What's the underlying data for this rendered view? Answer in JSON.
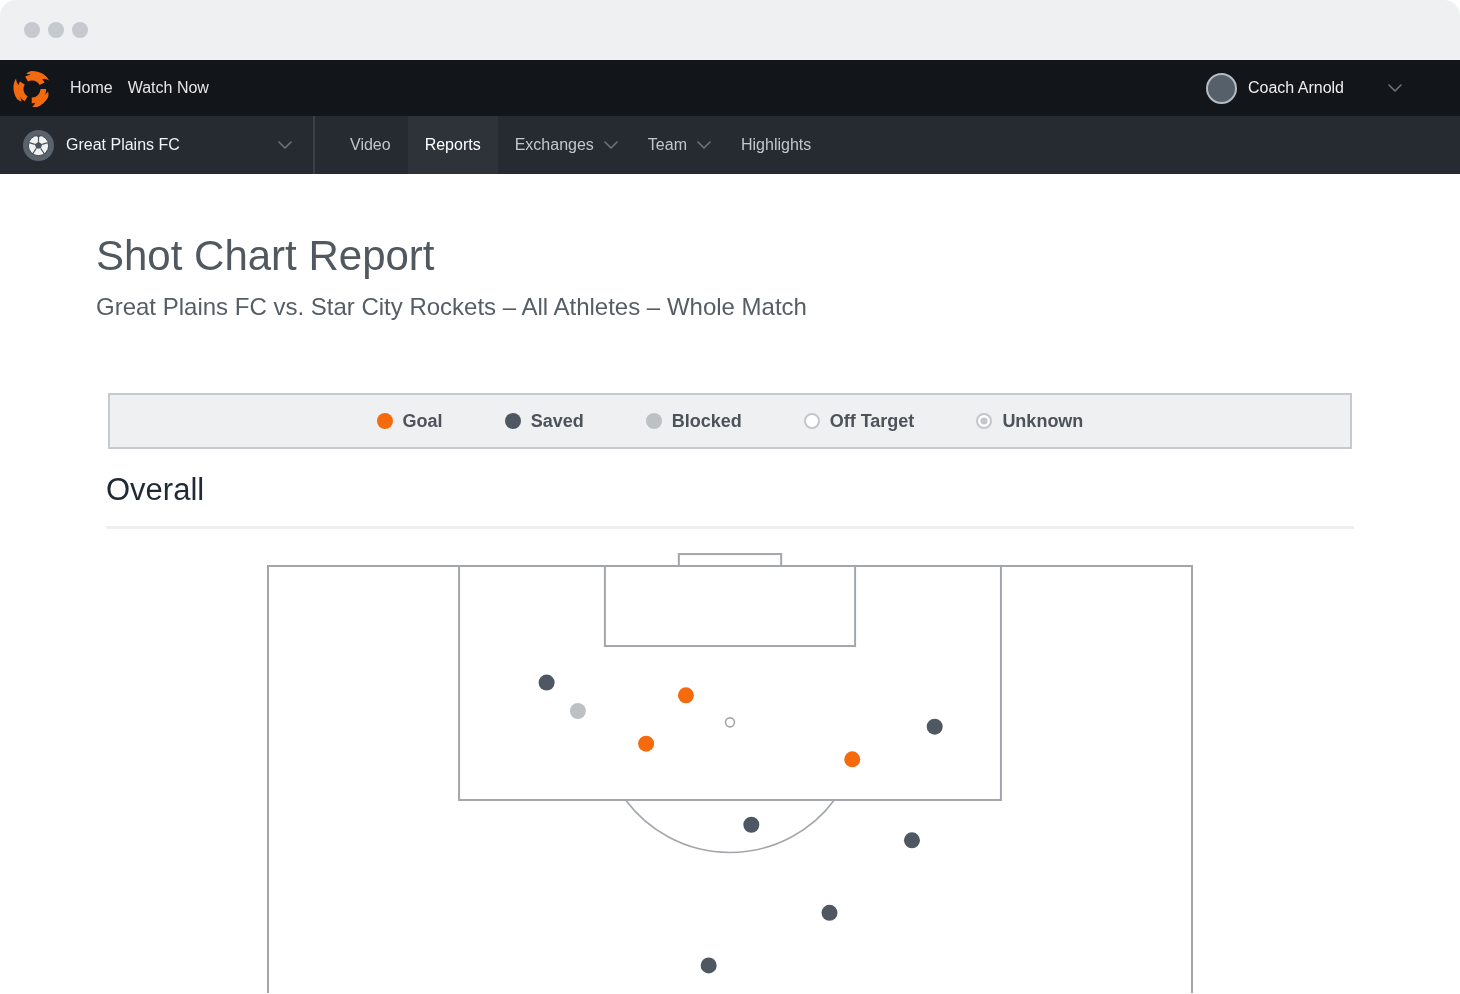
{
  "top_nav": {
    "links": [
      "Home",
      "Watch Now"
    ],
    "user": {
      "name": "Coach Arnold"
    }
  },
  "sub_nav": {
    "team_selector": {
      "label": "Great Plains FC"
    },
    "tabs": [
      {
        "label": "Video",
        "selected": false,
        "has_menu": false
      },
      {
        "label": "Reports",
        "selected": true,
        "has_menu": false
      },
      {
        "label": "Exchanges",
        "selected": false,
        "has_menu": true
      },
      {
        "label": "Team",
        "selected": false,
        "has_menu": true
      },
      {
        "label": "Highlights",
        "selected": false,
        "has_menu": false
      }
    ]
  },
  "report": {
    "title": "Shot Chart Report",
    "subtitle": "Great Plains FC vs. Star City Rockets – All Athletes – Whole Match",
    "legend": [
      {
        "label": "Goal",
        "kind": "filled",
        "color": "#f56a0d"
      },
      {
        "label": "Saved",
        "kind": "filled",
        "color": "#4e5762"
      },
      {
        "label": "Blocked",
        "kind": "filled",
        "color": "#bdc1c4"
      },
      {
        "label": "Off Target",
        "kind": "ring",
        "color": "#c3c6ca"
      },
      {
        "label": "Unknown",
        "kind": "ring-dot",
        "color": "#c3c6ca"
      }
    ],
    "section_heading": "Overall"
  }
}
